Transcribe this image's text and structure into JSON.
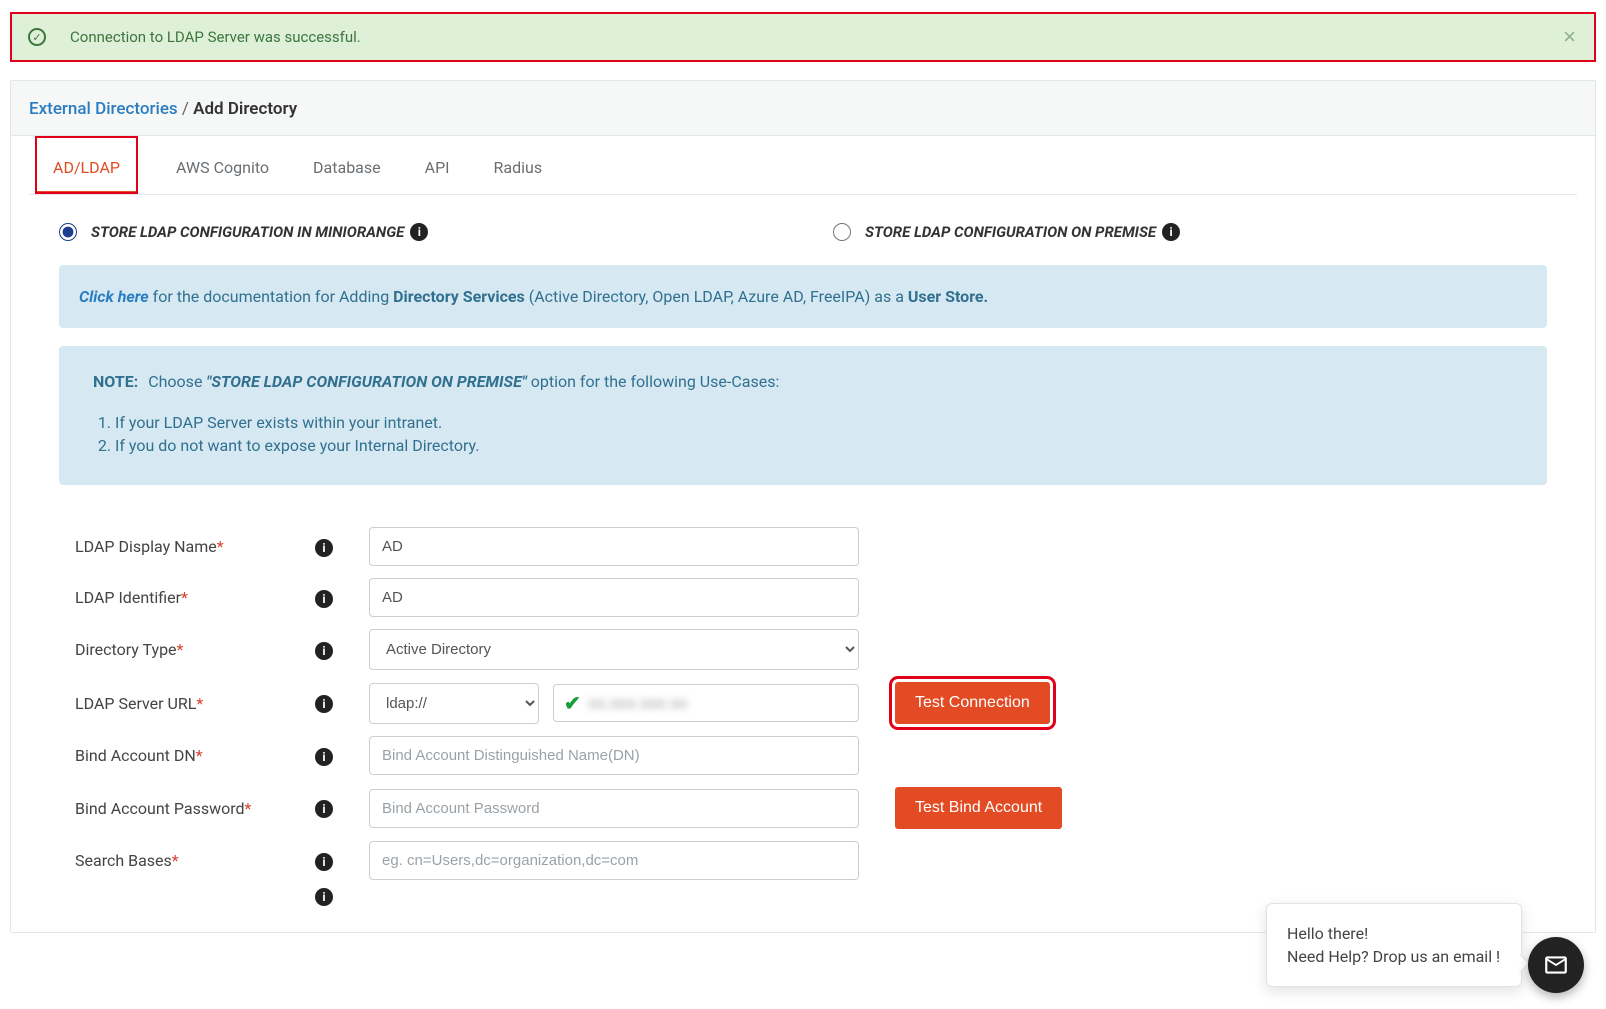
{
  "alert": {
    "message": "Connection to LDAP Server was successful."
  },
  "breadcrumb": {
    "parent": "External Directories",
    "current": "Add Directory"
  },
  "tabs": [
    "AD/LDAP",
    "AWS Cognito",
    "Database",
    "API",
    "Radius"
  ],
  "radio": {
    "miniorange": "STORE LDAP CONFIGURATION IN MINIORANGE",
    "onpremise": "STORE LDAP CONFIGURATION ON PREMISE"
  },
  "doc_callout": {
    "click_here": "Click here",
    "text_1": " for the documentation for Adding ",
    "dir_services": "Directory Services",
    "text_2": " (Active Directory, Open LDAP, Azure AD, FreeIPA) as a ",
    "user_store": "User Store."
  },
  "note": {
    "label": "NOTE:",
    "choose": "Choose",
    "quoted": "\"STORE LDAP CONFIGURATION ON PREMISE\"",
    "rest": " option for the following Use-Cases:",
    "items": [
      "If your LDAP Server exists within your intranet.",
      "If you do not want to expose your Internal Directory."
    ]
  },
  "form": {
    "display_name": {
      "label": "LDAP Display Name",
      "value": "AD"
    },
    "identifier": {
      "label": "LDAP Identifier",
      "value": "AD"
    },
    "dir_type": {
      "label": "Directory Type",
      "value": "Active Directory"
    },
    "server_url": {
      "label": "LDAP Server URL",
      "protocol": "ldap://",
      "host_masked": "xx.xxx.xxx.xx"
    },
    "bind_dn": {
      "label": "Bind Account DN",
      "placeholder": "Bind Account Distinguished Name(DN)"
    },
    "bind_pw": {
      "label": "Bind Account Password",
      "placeholder": "Bind Account Password"
    },
    "search_bases": {
      "label": "Search Bases",
      "placeholder": "eg. cn=Users,dc=organization,dc=com"
    }
  },
  "buttons": {
    "test_connection": "Test Connection",
    "test_bind": "Test Bind Account"
  },
  "chat": {
    "line1": "Hello there!",
    "line2": "Need Help? Drop us an email !"
  }
}
